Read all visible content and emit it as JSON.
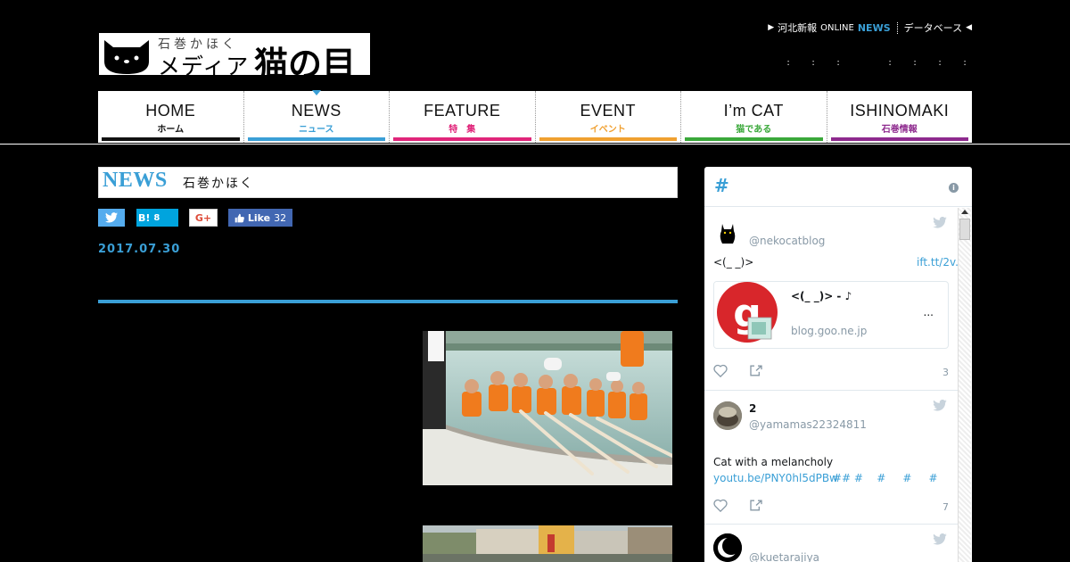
{
  "header": {
    "logo_small": "石巻かほく",
    "logo_media": "メディア",
    "logo_main": "猫の目",
    "toplink": {
      "kahoku": "河北新報",
      "online": "ONLINE",
      "news": "NEWS",
      "database": "データベース"
    },
    "dots": [
      ":",
      ":",
      ":",
      ":",
      ":",
      ":",
      ":"
    ]
  },
  "nav": {
    "items": [
      {
        "en": "HOME",
        "jp": "ホーム",
        "color": "#111111"
      },
      {
        "en": "NEWS",
        "jp": "ニュース",
        "color": "#3a9fd6"
      },
      {
        "en": "FEATURE",
        "jp": "特　集",
        "color": "#e0257a"
      },
      {
        "en": "EVENT",
        "jp": "イベント",
        "color": "#f0a030"
      },
      {
        "en": "I’m CAT",
        "jp": "猫である",
        "color": "#3aa83a"
      },
      {
        "en": "ISHINOMAKI",
        "jp": "石巻情報",
        "color": "#8e2a8e"
      }
    ]
  },
  "article": {
    "section_title": "NEWS",
    "section_sub": "石巻かほく",
    "date": "2017.07.30",
    "share": {
      "hatena_label": "B!",
      "hatena_count": "8",
      "gplus_label": "G+",
      "fb_label": "Like",
      "fb_count": "32"
    }
  },
  "sidebar": {
    "hash": "#",
    "info": "i",
    "tweets": [
      {
        "handle": "@nekocatblog",
        "text": "<(_ _)>",
        "link": "ift.tt/2v...",
        "card_title": "<(_ _)> - ♪",
        "card_dots": "...",
        "card_domain": "blog.goo.ne.jp",
        "count": "3"
      },
      {
        "name": "2",
        "handle": "@yamamas22324811",
        "text": "Cat with a melancholy",
        "link": "youtu.be/PNY0hl5dPBw",
        "tags": "## #    #     #     #",
        "count": "7"
      },
      {
        "handle": "@kuetarajiya"
      }
    ]
  }
}
